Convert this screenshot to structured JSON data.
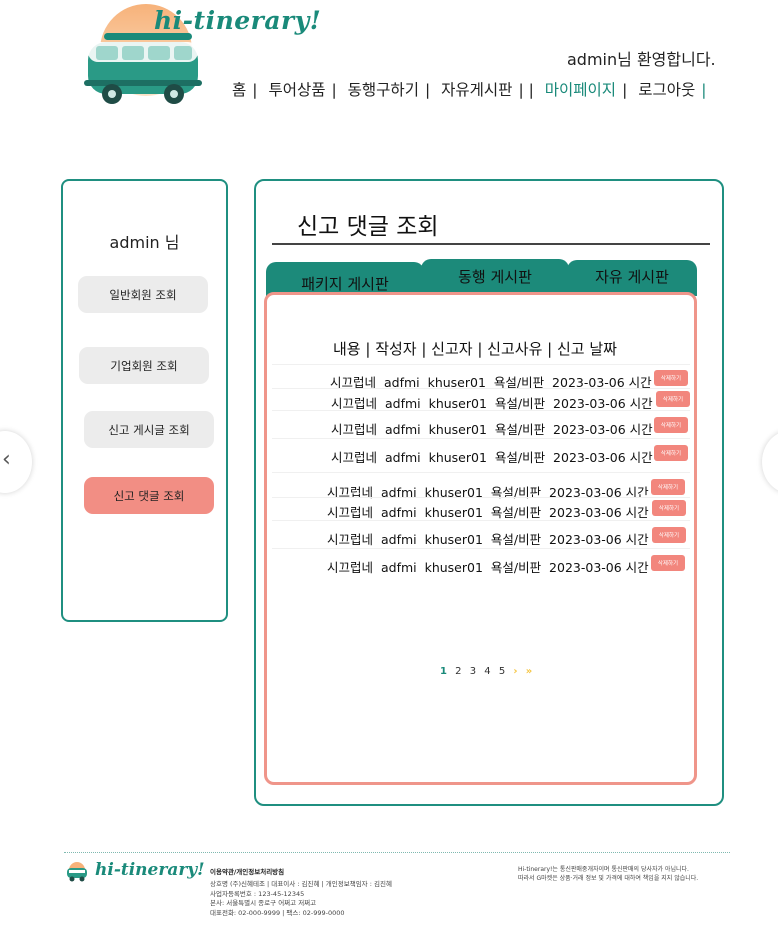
{
  "brand": {
    "name": "hi-tinerary!",
    "logo_icon": "camper-van-icon",
    "accent": "#1a8a7a",
    "sun_color": "#f4a66a"
  },
  "header": {
    "welcome": "admin님 환영합니다.",
    "nav": [
      {
        "label": "홈"
      },
      {
        "label": "투어상품"
      },
      {
        "label": "동행구하기"
      },
      {
        "label": "자유게시판"
      },
      {
        "label": "마이페이지",
        "active": true
      },
      {
        "label": "로그아웃"
      }
    ]
  },
  "sidebar": {
    "title": "admin 님",
    "items": [
      {
        "label": "일반회원 조회"
      },
      {
        "label": "기업회원 조회"
      },
      {
        "label": "신고 게시글 조회"
      },
      {
        "label": "신고 댓글 조회",
        "active": true
      }
    ]
  },
  "main": {
    "title": "신고 댓글 조회",
    "tabs": [
      {
        "label": "패키지 게시판"
      },
      {
        "label": "동행 게시판"
      },
      {
        "label": "자유 게시판"
      }
    ],
    "columns_header": "내용 | 작성자 | 신고자 | 신고사유 | 신고 날짜",
    "rows": [
      {
        "content": "시끄럽네",
        "author": "adfmi",
        "reporter": "khuser01",
        "reason": "욕설/비판",
        "date": "2023-03-06 시간",
        "action": "삭제하기"
      },
      {
        "content": "시끄럽네",
        "author": "adfmi",
        "reporter": "khuser01",
        "reason": "욕설/비판",
        "date": "2023-03-06 시간",
        "action": "삭제하기"
      },
      {
        "content": "시끄럽네",
        "author": "adfmi",
        "reporter": "khuser01",
        "reason": "욕설/비판",
        "date": "2023-03-06 시간",
        "action": "삭제하기"
      },
      {
        "content": "시끄럽네",
        "author": "adfmi",
        "reporter": "khuser01",
        "reason": "욕설/비판",
        "date": "2023-03-06 시간",
        "action": "삭제하기"
      },
      {
        "content": "시끄럽네",
        "author": "adfmi",
        "reporter": "khuser01",
        "reason": "욕설/비판",
        "date": "2023-03-06 시간",
        "action": "삭제하기"
      },
      {
        "content": "시끄럽네",
        "author": "adfmi",
        "reporter": "khuser01",
        "reason": "욕설/비판",
        "date": "2023-03-06 시간",
        "action": "삭제하기"
      },
      {
        "content": "시끄럽네",
        "author": "adfmi",
        "reporter": "khuser01",
        "reason": "욕설/비판",
        "date": "2023-03-06 시간",
        "action": "삭제하기"
      },
      {
        "content": "시끄럽네",
        "author": "adfmi",
        "reporter": "khuser01",
        "reason": "욕설/비판",
        "date": "2023-03-06 시간",
        "action": "삭제하기"
      }
    ],
    "pagination": {
      "pages": [
        "1",
        "2",
        "3",
        "4",
        "5"
      ],
      "current": "1",
      "next": "›",
      "last": "»"
    }
  },
  "footer": {
    "brand": "hi-tinerary!",
    "links": "이용약관/개인정보처리방침",
    "info": [
      "상호명 (주)신혜테조 | 대표이사 : 김진혜 | 개인정보책임자 : 김진혜",
      "사업자등록번호 : 123-45-12345",
      "본사: 서울특별시 종로구 어쩌고 저쩌고",
      "대표전화: 02-000-9999 | 팩스: 02-999-0000"
    ],
    "note": [
      "Hi-tinerary!는 통신판매중개자이며 통신판매의 당사자가 아닙니다.",
      "따라서 G마켓은 상품·거래 정보 및 가격에 대하여 책임을 지지 않습니다."
    ]
  }
}
